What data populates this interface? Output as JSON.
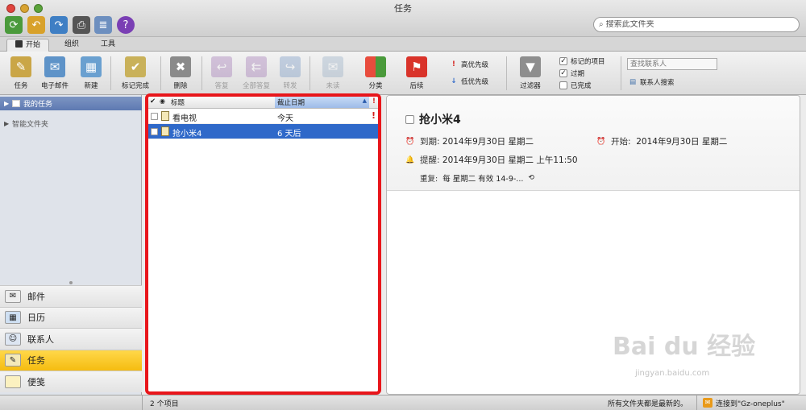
{
  "window": {
    "title": "任务"
  },
  "search": {
    "placeholder": "搜索此文件夹"
  },
  "ribbon_tabs": [
    {
      "label": "开始",
      "active": true
    },
    {
      "label": "组织",
      "active": false
    },
    {
      "label": "工具",
      "active": false
    }
  ],
  "ribbon": {
    "task": "任务",
    "email": "电子邮件",
    "new": "新建",
    "mark_complete": "标记完成",
    "delete": "删除",
    "reply": "答复",
    "reply_all": "全部答复",
    "forward": "转发",
    "unread": "未读",
    "categorize": "分类",
    "followup": "后续",
    "high_priority": "高优先级",
    "low_priority": "低优先级",
    "filter": "过滤器",
    "flagged_items": "标记的项目",
    "overdue": "过期",
    "completed": "已完成",
    "contact_search_placeholder": "查找联系人",
    "contact_search": "联系人搜索"
  },
  "folders": {
    "my_tasks": "我的任务",
    "smart_folders": "智能文件夹"
  },
  "nav": [
    {
      "label": "邮件",
      "icon": "mail-icon",
      "active": false
    },
    {
      "label": "日历",
      "icon": "calendar-icon",
      "active": false
    },
    {
      "label": "联系人",
      "icon": "contacts-icon",
      "active": false
    },
    {
      "label": "任务",
      "icon": "tasks-icon",
      "active": true
    },
    {
      "label": "便笺",
      "icon": "notes-icon",
      "active": false
    }
  ],
  "task_list": {
    "columns": {
      "title": "标题",
      "due": "截止日期",
      "priority": "!"
    },
    "rows": [
      {
        "title": "看电视",
        "due": "今天",
        "priority": "!",
        "selected": false
      },
      {
        "title": "抢小米4",
        "due": "6 天后",
        "priority": "",
        "selected": true
      }
    ]
  },
  "detail": {
    "title": "抢小米4",
    "due_label": "到期:",
    "due_value": "2014年9月30日 星期二",
    "start_label": "开始:",
    "start_value": "2014年9月30日 星期二",
    "reminder_label": "提醒:",
    "reminder_value": "2014年9月30日 星期二 上午11:50",
    "repeat_label": "重复:",
    "repeat_value": "每 星期二 有效 14-9-..."
  },
  "status": {
    "count": "2 个项目",
    "sync": "所有文件夹都是最新的。",
    "connection": "连接到\"Gz-oneplus\""
  },
  "watermark": {
    "main": "Bai du 经验",
    "sub": "jingyan.baidu.com"
  },
  "colors": {
    "highlight": "#e8161b",
    "selection": "#2f69c9",
    "active_nav": "#f5bc10"
  }
}
